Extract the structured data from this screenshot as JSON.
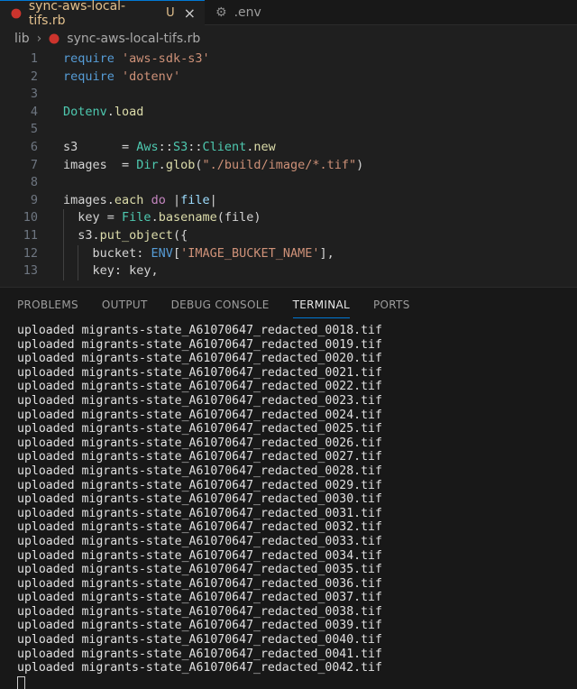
{
  "tabs": [
    {
      "name": "sync-aws-local-tifs.rb",
      "status": "U",
      "close": "×"
    },
    {
      "name": ".env"
    }
  ],
  "breadcrumb": {
    "folder": "lib",
    "separator": "›",
    "file": "sync-aws-local-tifs.rb"
  },
  "editor": {
    "lines": [
      {
        "n": "1",
        "tokens": [
          [
            "kw",
            "require"
          ],
          [
            "plain",
            " "
          ],
          [
            "str",
            "'aws-sdk-s3'"
          ]
        ]
      },
      {
        "n": "2",
        "tokens": [
          [
            "kw",
            "require"
          ],
          [
            "plain",
            " "
          ],
          [
            "str",
            "'dotenv'"
          ]
        ]
      },
      {
        "n": "3",
        "tokens": []
      },
      {
        "n": "4",
        "tokens": [
          [
            "cls",
            "Dotenv"
          ],
          [
            "plain",
            "."
          ],
          [
            "fn",
            "load"
          ]
        ]
      },
      {
        "n": "5",
        "tokens": []
      },
      {
        "n": "6",
        "tokens": [
          [
            "plain",
            "s3      = "
          ],
          [
            "cls",
            "Aws"
          ],
          [
            "plain",
            "::"
          ],
          [
            "cls",
            "S3"
          ],
          [
            "plain",
            "::"
          ],
          [
            "cls",
            "Client"
          ],
          [
            "plain",
            "."
          ],
          [
            "fn",
            "new"
          ]
        ]
      },
      {
        "n": "7",
        "tokens": [
          [
            "plain",
            "images  = "
          ],
          [
            "cls",
            "Dir"
          ],
          [
            "plain",
            "."
          ],
          [
            "fn",
            "glob"
          ],
          [
            "plain",
            "("
          ],
          [
            "str",
            "\"./build/image/*.tif\""
          ],
          [
            "plain",
            ")"
          ]
        ]
      },
      {
        "n": "8",
        "tokens": []
      },
      {
        "n": "9",
        "tokens": [
          [
            "plain",
            "images."
          ],
          [
            "fn",
            "each"
          ],
          [
            "plain",
            " "
          ],
          [
            "ctl",
            "do"
          ],
          [
            "plain",
            " |"
          ],
          [
            "var",
            "file"
          ],
          [
            "plain",
            "|"
          ]
        ]
      },
      {
        "n": "10",
        "indent": 1,
        "tokens": [
          [
            "plain",
            "key = "
          ],
          [
            "cls",
            "File"
          ],
          [
            "plain",
            "."
          ],
          [
            "fn",
            "basename"
          ],
          [
            "plain",
            "(file)"
          ]
        ]
      },
      {
        "n": "11",
        "indent": 1,
        "tokens": [
          [
            "plain",
            "s3."
          ],
          [
            "fn",
            "put_object"
          ],
          [
            "plain",
            "({"
          ]
        ]
      },
      {
        "n": "12",
        "indent": 2,
        "tokens": [
          [
            "plain",
            "bucket: "
          ],
          [
            "kw",
            "ENV"
          ],
          [
            "plain",
            "["
          ],
          [
            "str",
            "'IMAGE_BUCKET_NAME'"
          ],
          [
            "plain",
            "],"
          ]
        ]
      },
      {
        "n": "13",
        "indent": 2,
        "tokens": [
          [
            "plain",
            "key: key,"
          ]
        ]
      }
    ]
  },
  "panel": {
    "tabs": [
      "PROBLEMS",
      "OUTPUT",
      "DEBUG CONSOLE",
      "TERMINAL",
      "PORTS"
    ],
    "active_tab": "TERMINAL",
    "terminal_lines": [
      "uploaded migrants-state_A61070647_redacted_0018.tif",
      "uploaded migrants-state_A61070647_redacted_0019.tif",
      "uploaded migrants-state_A61070647_redacted_0020.tif",
      "uploaded migrants-state_A61070647_redacted_0021.tif",
      "uploaded migrants-state_A61070647_redacted_0022.tif",
      "uploaded migrants-state_A61070647_redacted_0023.tif",
      "uploaded migrants-state_A61070647_redacted_0024.tif",
      "uploaded migrants-state_A61070647_redacted_0025.tif",
      "uploaded migrants-state_A61070647_redacted_0026.tif",
      "uploaded migrants-state_A61070647_redacted_0027.tif",
      "uploaded migrants-state_A61070647_redacted_0028.tif",
      "uploaded migrants-state_A61070647_redacted_0029.tif",
      "uploaded migrants-state_A61070647_redacted_0030.tif",
      "uploaded migrants-state_A61070647_redacted_0031.tif",
      "uploaded migrants-state_A61070647_redacted_0032.tif",
      "uploaded migrants-state_A61070647_redacted_0033.tif",
      "uploaded migrants-state_A61070647_redacted_0034.tif",
      "uploaded migrants-state_A61070647_redacted_0035.tif",
      "uploaded migrants-state_A61070647_redacted_0036.tif",
      "uploaded migrants-state_A61070647_redacted_0037.tif",
      "uploaded migrants-state_A61070647_redacted_0038.tif",
      "uploaded migrants-state_A61070647_redacted_0039.tif",
      "uploaded migrants-state_A61070647_redacted_0040.tif",
      "uploaded migrants-state_A61070647_redacted_0041.tif",
      "uploaded migrants-state_A61070647_redacted_0042.tif"
    ]
  },
  "colors": {
    "accent": "#0078d4",
    "ruby": "#cc342d",
    "modified": "#e2c08d"
  },
  "icons": {
    "ruby_file": "ruby-icon",
    "env_file": "gear-icon",
    "close": "close-icon",
    "cursor": "terminal-cursor"
  }
}
